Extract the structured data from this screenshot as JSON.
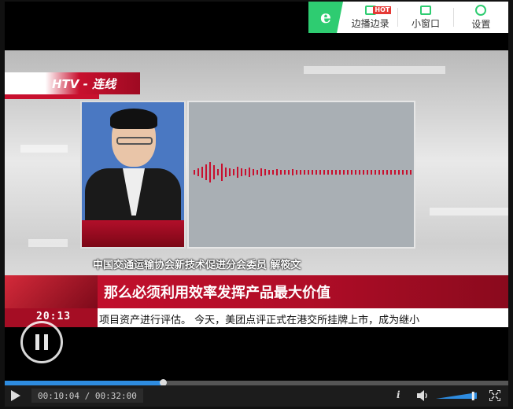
{
  "toolbar": {
    "logo": "e",
    "items": [
      {
        "label": "边播边录",
        "icon": "record-camera-icon",
        "badge": "HOT"
      },
      {
        "label": "小窗口",
        "icon": "mini-window-icon"
      },
      {
        "label": "设置",
        "icon": "gear-icon"
      }
    ],
    "accent": "#2ecc71"
  },
  "video": {
    "logo_text": "HTV - 连线",
    "caption_name": "中国交通运输协会新技术促进分会委员 解筱文",
    "headline": "那么必须利用效率发挥产品最大价值",
    "clock": "20:13",
    "ticker": "项目资产进行评估。      今天，美团点评正式在港交所挂牌上市，成为继小"
  },
  "player": {
    "time": "00:10:04 / 00:32:00",
    "progress_fraction": 0.3146,
    "volume_fraction": 0.9,
    "info_label": "i"
  }
}
